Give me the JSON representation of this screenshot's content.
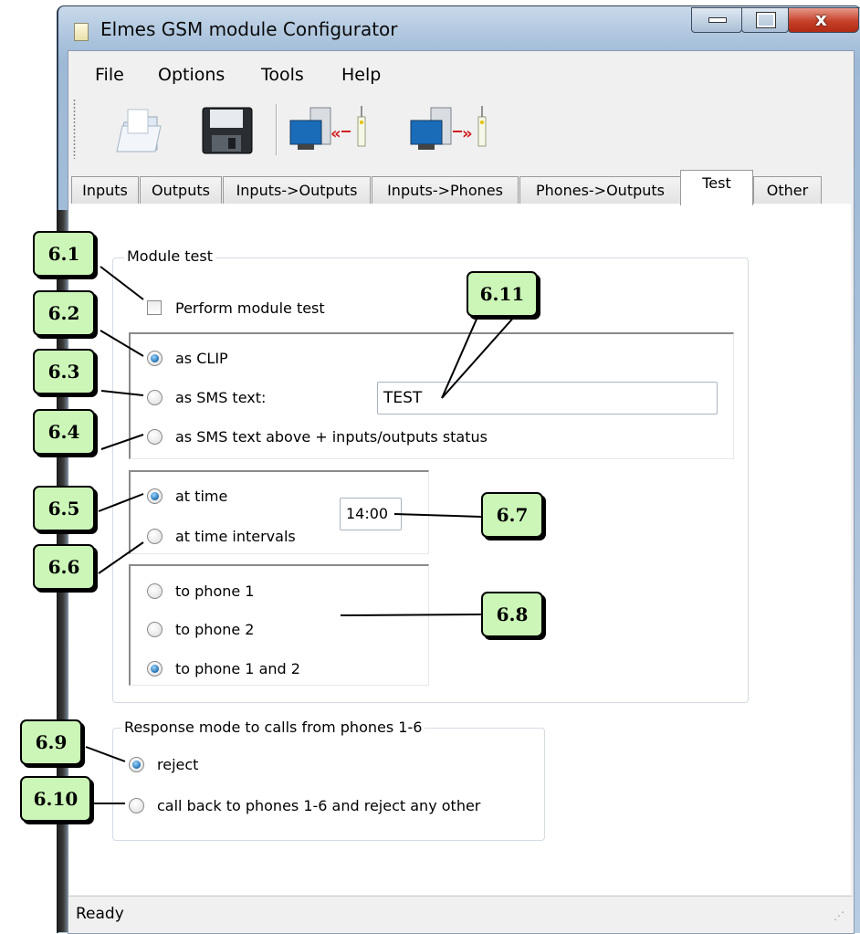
{
  "window": {
    "title": "Elmes GSM module Configurator"
  },
  "menu": [
    "File",
    "Options",
    "Tools",
    "Help"
  ],
  "toolbar": [
    {
      "icon": "open-folder-icon"
    },
    {
      "icon": "save-disk-icon"
    },
    {
      "icon": "read-from-module-icon"
    },
    {
      "icon": "write-to-module-icon"
    }
  ],
  "tabs": [
    "Inputs",
    "Outputs",
    "Inputs->Outputs",
    "Inputs->Phones",
    "Phones->Outputs",
    "Test",
    "Other"
  ],
  "active_tab": "Test",
  "module_test": {
    "legend": "Module test",
    "perform_label": "Perform module test",
    "perform_checked": false,
    "mode": {
      "clip": "as CLIP",
      "sms": "as SMS text:",
      "sms_status": "as SMS text above + inputs/outputs status",
      "selected": "as CLIP"
    },
    "sms_text_value": "TEST",
    "timing": {
      "at_time": "at time",
      "intervals": "at time intervals",
      "selected": "at time",
      "time_value": "14:00"
    },
    "recipients": {
      "phone1": "to phone 1",
      "phone2": "to phone 2",
      "both": "to phone 1 and 2",
      "selected": "to phone 1 and 2"
    }
  },
  "response": {
    "legend": "Response mode to calls from phones 1-6",
    "reject": "reject",
    "call_back": "call back to phones 1-6 and reject any other",
    "selected": "reject"
  },
  "status": "Ready",
  "callouts": {
    "c61": "6.1",
    "c62": "6.2",
    "c63": "6.3",
    "c64": "6.4",
    "c65": "6.5",
    "c66": "6.6",
    "c67": "6.7",
    "c68": "6.8",
    "c69": "6.9",
    "c610": "6.10",
    "c611": "6.11"
  },
  "colors": {
    "callout_fill": "#ccf6b8",
    "radio_selected": "#1f6fb2",
    "close_button": "#c6402a"
  }
}
